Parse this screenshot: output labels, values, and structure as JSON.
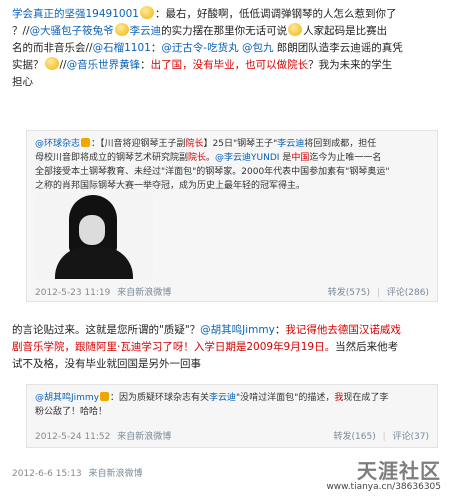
{
  "post1": {
    "lines": [
      {
        "segments": [
          {
            "t": "学会真正的坚强19491001",
            "c": "link"
          },
          {
            "t": "emoji",
            "c": "emoji"
          },
          {
            "t": "：最右，好酸啊，低低调调弹钢琴的人怎么惹到你了",
            "c": ""
          }
        ]
      },
      {
        "segments": [
          {
            "t": "？//",
            "c": ""
          },
          {
            "t": "@大骚包子筱兔爷",
            "c": "link"
          },
          {
            "t": "emoji",
            "c": "emoji"
          },
          {
            "t": "李云迪",
            "c": "link"
          },
          {
            "t": "的实力摆在那里你无话可说",
            "c": ""
          },
          {
            "t": "emoji",
            "c": "emoji"
          },
          {
            "t": "人家起码是比赛出",
            "c": ""
          }
        ]
      },
      {
        "segments": [
          {
            "t": "名的而非音乐会//",
            "c": ""
          },
          {
            "t": "@石榴1101",
            "c": "link"
          },
          {
            "t": "：",
            "c": ""
          },
          {
            "t": "@迂古令-吃货丸",
            "c": "link"
          },
          {
            "t": " ",
            "c": ""
          },
          {
            "t": "@包九",
            "c": "link"
          },
          {
            "t": " 郎朗团队造李云迪谣的真凭",
            "c": ""
          }
        ]
      },
      {
        "segments": [
          {
            "t": "实据？",
            "c": ""
          },
          {
            "t": "emoji",
            "c": "emoji"
          },
          {
            "t": "//",
            "c": ""
          },
          {
            "t": "@音乐世界黄锋",
            "c": "link"
          },
          {
            "t": "：",
            "c": ""
          },
          {
            "t": "出了国，没有毕业，也可以做院长",
            "c": "red"
          },
          {
            "t": "？我为未来的学生",
            "c": ""
          }
        ]
      },
      {
        "segments": [
          {
            "t": "担心",
            "c": ""
          }
        ]
      }
    ]
  },
  "quote1": {
    "lines": [
      {
        "segments": [
          {
            "t": "@环球杂志",
            "c": "link"
          },
          {
            "t": "V",
            "c": "badge"
          },
          {
            "t": "：【川音将迎钢琴王子副",
            "c": ""
          },
          {
            "t": "院长",
            "c": "red"
          },
          {
            "t": "】25日\"钢琴王子\"",
            "c": ""
          },
          {
            "t": "李云迪",
            "c": "link"
          },
          {
            "t": "将回到成都，担任",
            "c": ""
          }
        ]
      },
      {
        "segments": [
          {
            "t": "母校川音即将成立的钢琴艺术研究院副",
            "c": ""
          },
          {
            "t": "院长",
            "c": "red"
          },
          {
            "t": "。",
            "c": ""
          },
          {
            "t": "@李云迪YUNDI",
            "c": "link"
          },
          {
            "t": " 是",
            "c": ""
          },
          {
            "t": "中国",
            "c": "red"
          },
          {
            "t": "迄今为止唯一一名",
            "c": ""
          }
        ]
      },
      {
        "segments": [
          {
            "t": "全部接受本土钢琴教育、未经过\"洋面包\"的钢琴家。2000年代表中国参加素有\"钢琴奥运\"",
            "c": ""
          }
        ]
      },
      {
        "segments": [
          {
            "t": "之称的肖邦国际钢琴大赛一举夺冠，成为历史上最年轻的冠军得主。",
            "c": ""
          }
        ]
      }
    ],
    "meta_time": "2012-5-23 11:19",
    "meta_source": "来自新浪微博",
    "repost": "转发(575)",
    "sep": "|",
    "comment": "评论(286)"
  },
  "post2": {
    "lines": [
      {
        "segments": [
          {
            "t": "的言论贴过来。这就是您所谓的\"质疑\"？",
            "c": ""
          },
          {
            "t": "@胡其鸣Jimmy",
            "c": "link"
          },
          {
            "t": "：",
            "c": ""
          },
          {
            "t": "我记得他去德国汉诺威戏",
            "c": "red"
          }
        ]
      },
      {
        "segments": [
          {
            "t": "剧音乐学院，跟随阿里·瓦迪学习了呀！入学日期是2009年9月19日。",
            "c": "red"
          },
          {
            "t": "当然后来他考",
            "c": ""
          }
        ]
      },
      {
        "segments": [
          {
            "t": "试不及格，没有毕业就回国是另外一回事",
            "c": ""
          }
        ]
      }
    ]
  },
  "quote2": {
    "lines": [
      {
        "segments": [
          {
            "t": "@胡其鸣Jimmy",
            "c": "link"
          },
          {
            "t": "V",
            "c": "badge"
          },
          {
            "t": "：因为质疑环球杂志有关",
            "c": ""
          },
          {
            "t": "李云迪",
            "c": "link"
          },
          {
            "t": "\"没啃过洋面包\"的描述，",
            "c": ""
          },
          {
            "t": "我",
            "c": "red"
          },
          {
            "t": "现在成了李",
            "c": ""
          }
        ]
      },
      {
        "segments": [
          {
            "t": "粉公敌了！哈哈！",
            "c": ""
          }
        ]
      }
    ],
    "meta_time": "2012-5-24 11:52",
    "meta_source": "来自新浪微博",
    "repost": "转发(165)",
    "sep": "|",
    "comment": "评论(37)"
  },
  "footer": {
    "time": "2012-6-6 15:13",
    "source": "来自新浪微博"
  },
  "watermark": {
    "brand": "天涯社区",
    "url": "www.tianya.cn/38636305"
  }
}
